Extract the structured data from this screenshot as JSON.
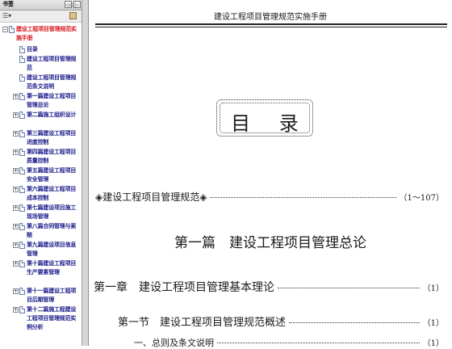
{
  "sidebar": {
    "title": "书签",
    "header_buttons": [
      "◁◁",
      "▷"
    ],
    "toolbar": {
      "options_label": "☰▾"
    },
    "items": [
      {
        "label": "建设工程项目管理规范实施手册",
        "selected": true,
        "expander": "−",
        "level": 0
      },
      {
        "label": "目录",
        "selected": false,
        "expander": "",
        "level": 1
      },
      {
        "label": "建设工程项目管理规范",
        "selected": false,
        "expander": "",
        "level": 1
      },
      {
        "label": "建设工程项目管理规范条文说明",
        "selected": false,
        "expander": "",
        "level": 1
      },
      {
        "label": "第一篇建设工程项目管理总论",
        "selected": false,
        "expander": "+",
        "level": 1
      },
      {
        "label": "第二篇施工组织设计",
        "selected": false,
        "expander": "+",
        "level": 1
      },
      {
        "label": "第三篇建设工程项目进度控制",
        "selected": false,
        "expander": "+",
        "level": 1
      },
      {
        "label": "第四篇建设工程项目质量控制",
        "selected": false,
        "expander": "+",
        "level": 1
      },
      {
        "label": "第五篇建设工程项目安全管理",
        "selected": false,
        "expander": "+",
        "level": 1
      },
      {
        "label": "第六篇建设工程项目成本控制",
        "selected": false,
        "expander": "+",
        "level": 1
      },
      {
        "label": "第七篇建设项目施工现场管理",
        "selected": false,
        "expander": "+",
        "level": 1
      },
      {
        "label": "第八篇合同管理与索赔",
        "selected": false,
        "expander": "+",
        "level": 1
      },
      {
        "label": "第九篇建设项目信息管理",
        "selected": false,
        "expander": "+",
        "level": 1
      },
      {
        "label": "第十篇建设工程项目生产要素管理",
        "selected": false,
        "expander": "+",
        "level": 1
      },
      {
        "label": "第十一篇建设工程项目后期管理",
        "selected": false,
        "expander": "+",
        "level": 1
      },
      {
        "label": "第十二篇施工程建设工程项目管理规范实例分析",
        "selected": false,
        "expander": "+",
        "level": 1
      }
    ]
  },
  "page": {
    "running_head": "建设工程项目管理规范实施手册",
    "toc_title": "目  录",
    "toc": [
      {
        "text": "◈建设工程项目管理规范◈",
        "page": "（1～107）"
      },
      {
        "text": "第一章　建设工程项目管理基本理论",
        "page": "（1）"
      },
      {
        "text": "第一节　建设工程项目管理规范概述",
        "page": "（1）"
      },
      {
        "text": "一、总则及条文说明",
        "page": "（1）"
      }
    ],
    "part_title": "第一篇　建设工程项目管理总论"
  },
  "colors": {
    "sidebar_bg": "#f0f0f0",
    "bookmark_text": "#1a1a8a",
    "bookmark_selected": "#d8151b",
    "page_bg": "#ffffff"
  }
}
